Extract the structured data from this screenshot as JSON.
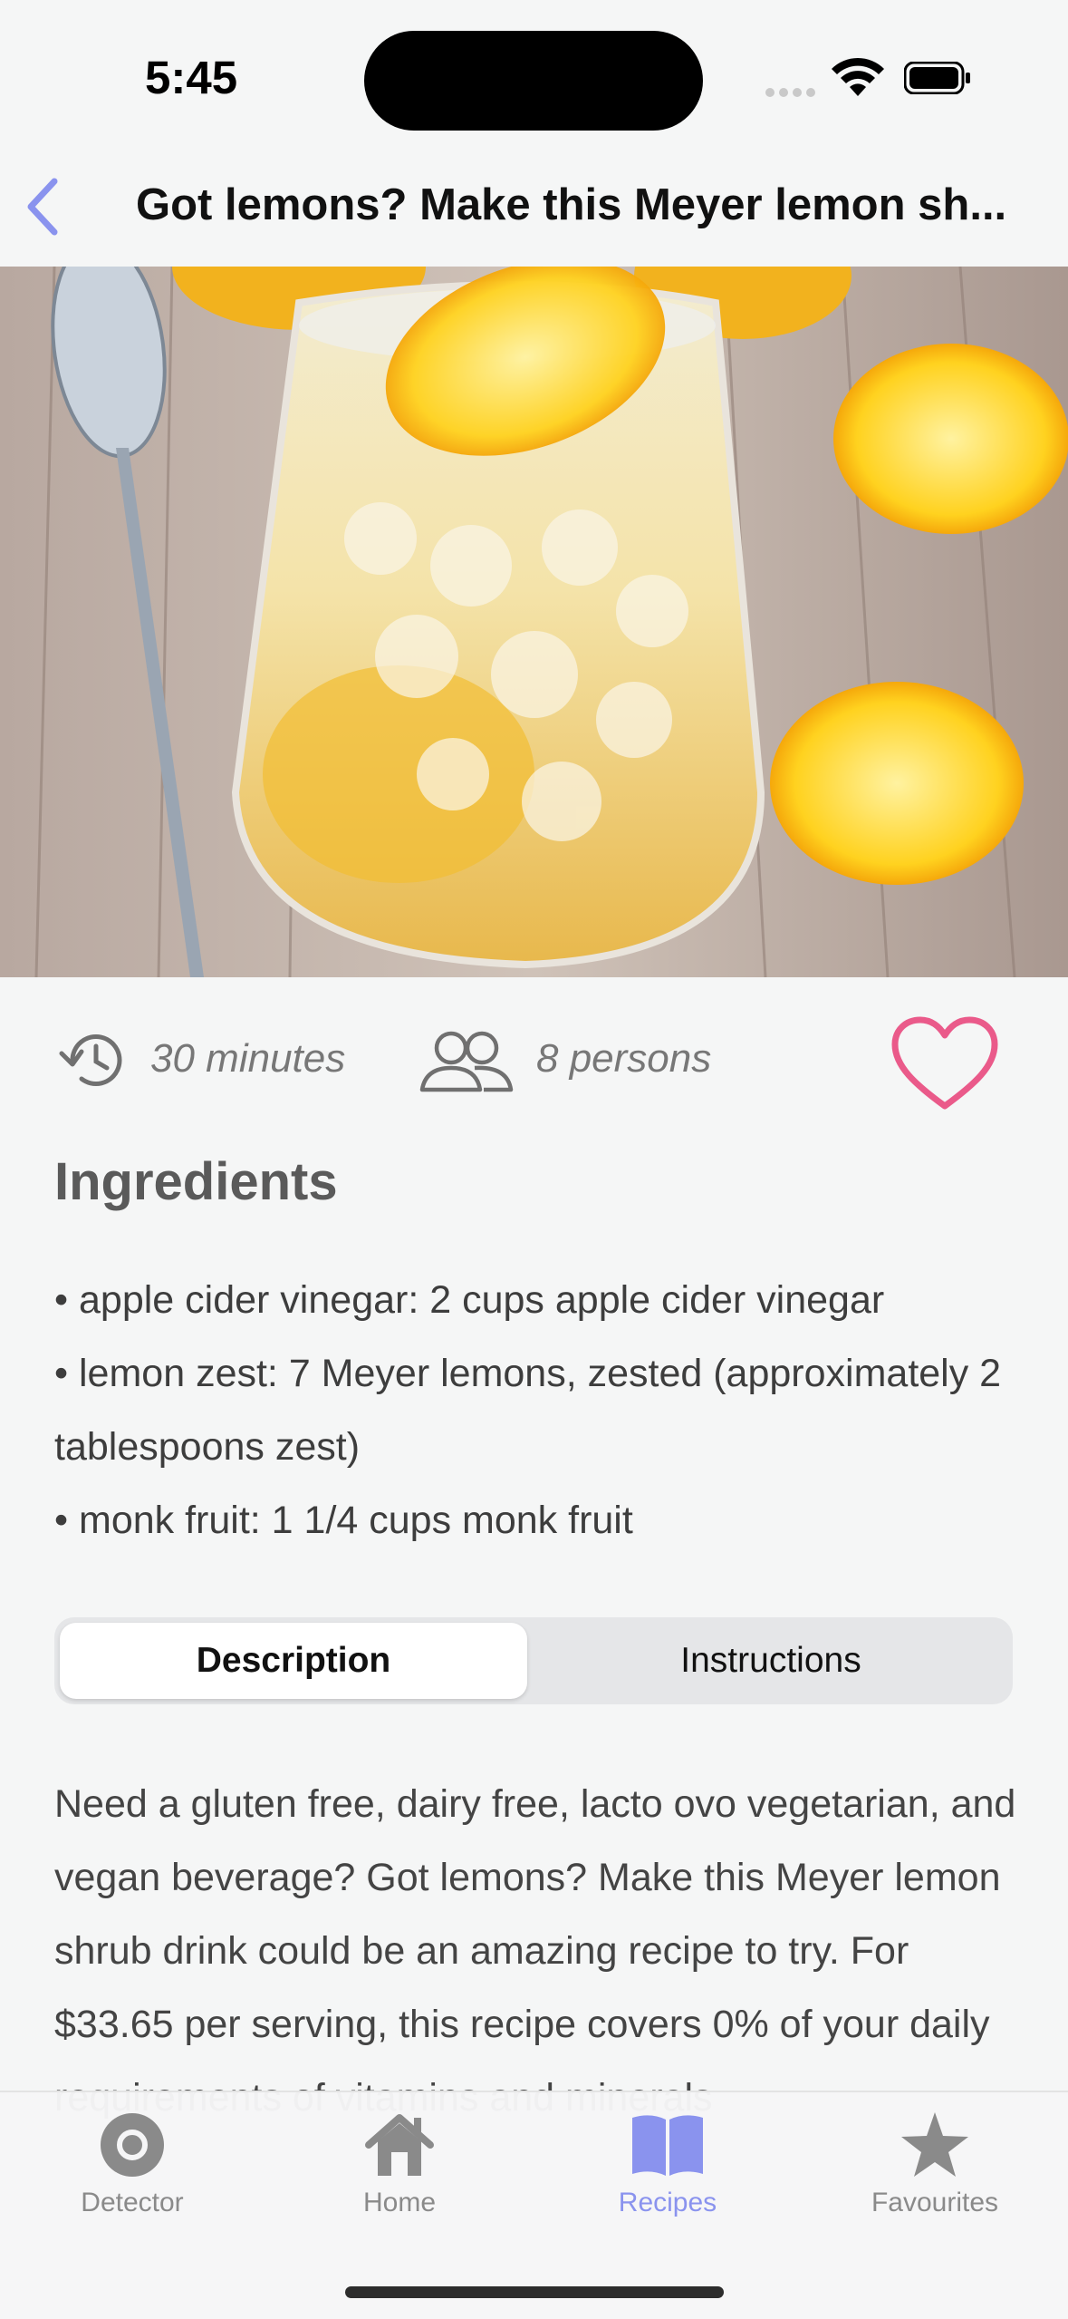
{
  "status": {
    "time": "5:45"
  },
  "nav": {
    "title": "Got lemons? Make this Meyer lemon sh..."
  },
  "colors": {
    "accent": "#8a93ee",
    "favorite": "#ea5a8a",
    "background": "#f5f6f6"
  },
  "recipe": {
    "duration": "30 minutes",
    "servings": "8 persons",
    "favorited": false
  },
  "ingredients": {
    "title": "Ingredients",
    "items": [
      "• apple cider vinegar: 2 cups apple cider vinegar",
      "• lemon zest: 7 Meyer lemons, zested (approximately 2 tablespoons zest)",
      "• monk fruit: 1 1/4 cups monk fruit"
    ]
  },
  "segments": {
    "active": "Description",
    "inactive": "Instructions"
  },
  "description": "Need a gluten free, dairy free, lacto ovo vegetarian, and vegan beverage? Got lemons? Make this Meyer lemon shrub drink could be an amazing recipe to try. For $33.65 per serving, this recipe covers 0% of your daily requirements of vitamins and minerals",
  "tabs": [
    {
      "label": "Detector",
      "icon": "detector-icon"
    },
    {
      "label": "Home",
      "icon": "house-icon"
    },
    {
      "label": "Recipes",
      "icon": "book-icon",
      "active": true
    },
    {
      "label": "Favourites",
      "icon": "star-icon"
    }
  ]
}
